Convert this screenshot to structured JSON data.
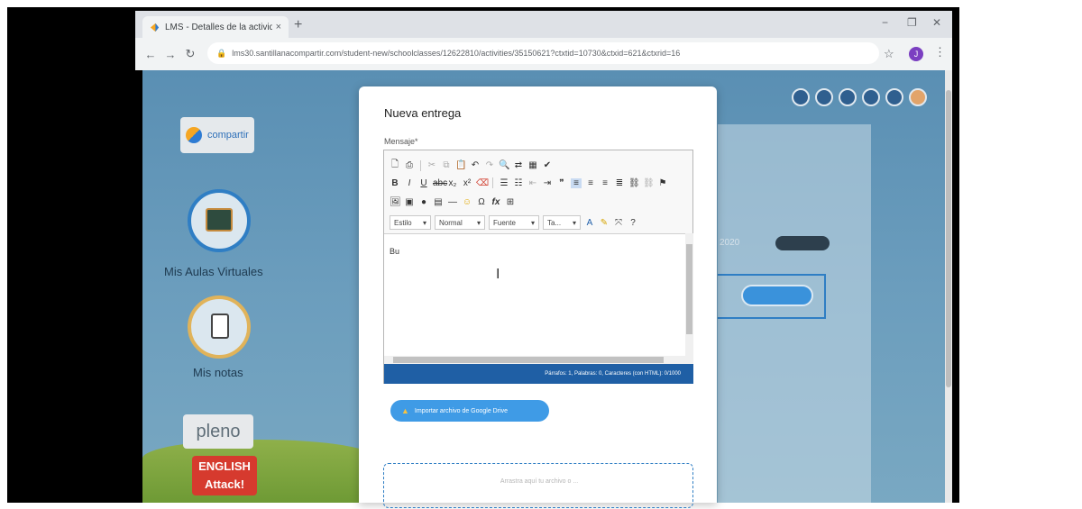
{
  "browser": {
    "tab_title": "LMS - Detalles de la actividad",
    "tab_close": "×",
    "new_tab": "+",
    "url": "lms30.santillanacompartir.com/student-new/schoolclasses/12622810/activities/35150621?ctxtid=10730&ctxid=621&ctxrid=16",
    "profile_initial": "J",
    "min": "−",
    "restore": "❐",
    "close": "✕"
  },
  "sidebar": {
    "logo_text": "compartir",
    "aulas_label": "Mis Aulas Virtuales",
    "notas_label": "Mis notas",
    "pleno_text": "pleno",
    "english_top": "ENGLISH",
    "english_bottom": "Attack!"
  },
  "background": {
    "date_text": "2020"
  },
  "modal": {
    "title": "Nueva entrega",
    "message_label": "Mensaje*",
    "toolbar_combos": [
      "Estilo",
      "Normal",
      "Fuente",
      "Ta..."
    ],
    "toolbar_help": "?",
    "editor_text": "Bu",
    "status_text": "Párrafos: 1, Palabras: 0, Caracteres (con HTML): 0/1000",
    "gdrive_button": "Importar archivo de Google Drive",
    "dropzone_text": "Arrastra aquí tu archivo o ..."
  }
}
